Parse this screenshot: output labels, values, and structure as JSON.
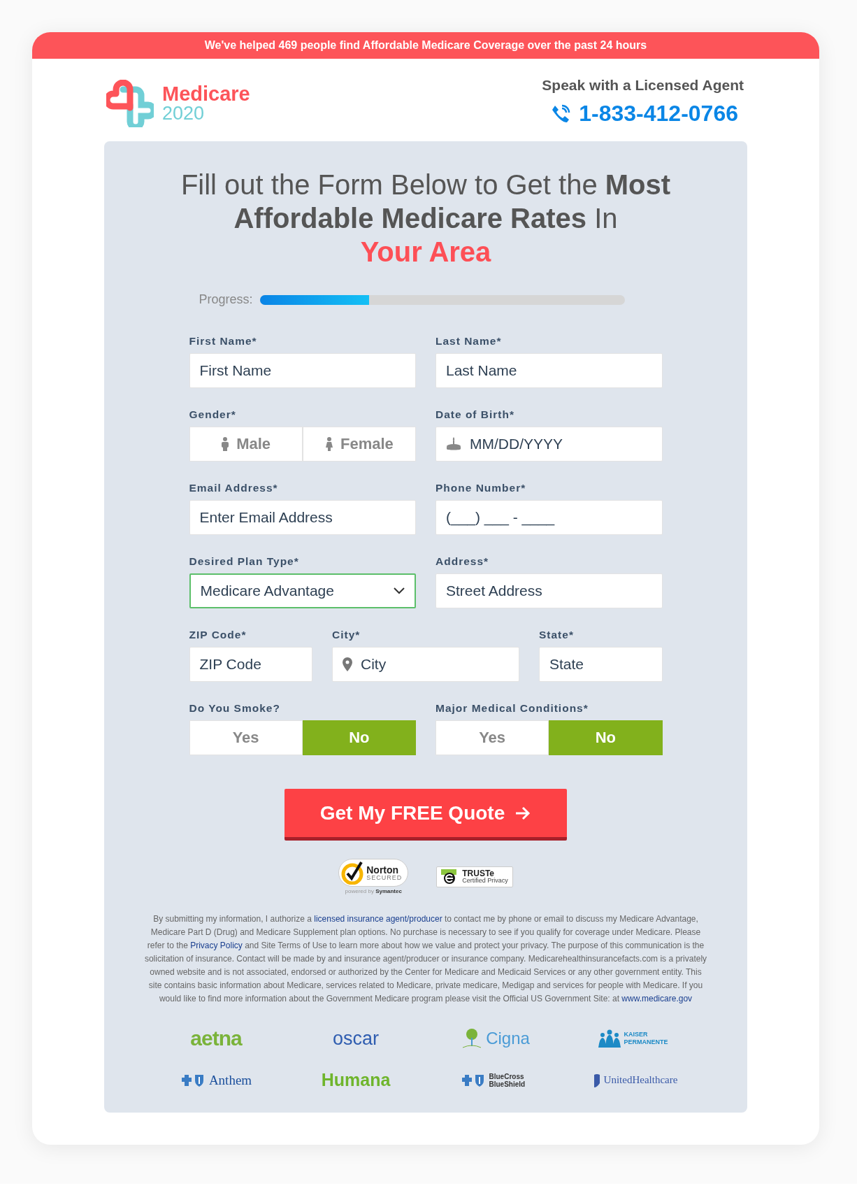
{
  "banner": "We've helped 469 people find Affordable Medicare Coverage over the past 24 hours",
  "header": {
    "brand_name": "Medicare",
    "brand_year": "2020",
    "agent_label": "Speak with a Licensed Agent",
    "phone": "1-833-412-0766"
  },
  "form": {
    "heading": "Fill out the Form Below to Get the **Most Affordable Medicare Rates** In",
    "heading_highlight": "Your Area",
    "progress": {
      "label": "Progress:",
      "level": 0.3
    },
    "rows": [
      {
        "fields": [
          {
            "kind": "text",
            "label": "First Name*",
            "placeholder": "First Name"
          },
          {
            "kind": "text",
            "label": "Last Name*",
            "placeholder": "Last Name"
          }
        ]
      },
      {
        "fields": [
          {
            "kind": "choice",
            "label": "Gender*",
            "options": [
              {
                "label": "Male",
                "kind": "male",
                "selected": false
              },
              {
                "label": "Female",
                "kind": "female",
                "selected": false
              }
            ]
          },
          {
            "kind": "date",
            "label": "Date of Birth*",
            "placeholder": "MM/DD/YYYY"
          }
        ]
      },
      {
        "fields": [
          {
            "kind": "text",
            "label": "Email Address*",
            "placeholder": "Enter Email Address"
          },
          {
            "kind": "text",
            "label": "Phone Number*",
            "placeholder": "(___) ___ - ____"
          }
        ]
      },
      {
        "fields": [
          {
            "kind": "select",
            "label": "Desired Plan Type*",
            "value": "Medicare Advantage",
            "valid": true
          },
          {
            "kind": "text",
            "label": "Address*",
            "placeholder": "Street Address"
          }
        ]
      },
      {
        "fields": [
          {
            "kind": "text",
            "label": "ZIP Code*",
            "placeholder": "ZIP Code"
          },
          {
            "kind": "city",
            "label": "City*",
            "placeholder": "City"
          },
          {
            "kind": "text",
            "label": "State*",
            "placeholder": "State"
          }
        ]
      },
      {
        "fields": [
          {
            "kind": "choice",
            "label": "Do You Smoke?",
            "options": [
              {
                "label": "Yes",
                "selected": false
              },
              {
                "label": "No",
                "selected": true
              }
            ]
          },
          {
            "kind": "choice",
            "label": "Major Medical Conditions*",
            "options": [
              {
                "label": "Yes",
                "selected": false
              },
              {
                "label": "No",
                "selected": true
              }
            ]
          }
        ]
      }
    ],
    "submit": "Get My FREE Quote"
  },
  "seals": {
    "norton": {
      "name": "Norton",
      "status": "SECURED",
      "powered_by": "powered by",
      "company": "Symantec"
    },
    "truste": {
      "name": "TRUSTe",
      "subtitle": "Certified Privacy"
    }
  },
  "disclaimer": [
    {
      "kind": "text",
      "text": "By submitting my information, I authorize a "
    },
    {
      "kind": "link",
      "text": "licensed insurance agent/producer"
    },
    {
      "kind": "text",
      "text": " to contact me by phone or email to discuss my Medicare Advantage, Medicare Part D (Drug) and Medicare Supplement plan options. No purchase is necessary to see if you qualify for coverage under Medicare. Please refer to the "
    },
    {
      "kind": "link",
      "text": "Privacy Policy"
    },
    {
      "kind": "text",
      "text": " and Site Terms of Use to learn more about how we value and protect your privacy. The purpose of this communication is the solicitation of insurance. Contact will be made by and insurance agent/producer or insurance company. Medicarehealthinsurancefacts.com is a privately owned website and is not associated, endorsed or authorized by the Center for Medicare and Medicaid Services or any other government entity. This site contains basic information about Medicare, services related to Medicare, private medicare, Medigap and services for people with Medicare. If you would like to find more information about the Government Medicare program please visit the Official US Government Site: at "
    },
    {
      "kind": "link",
      "text": "www.medicare.gov"
    }
  ],
  "insurers": [
    {
      "kind": "aetna",
      "name": "aetna"
    },
    {
      "kind": "oscar",
      "name": "oscar"
    },
    {
      "kind": "cigna",
      "name": "Cigna"
    },
    {
      "kind": "kaiser",
      "name": "KAISER PERMANENTE"
    },
    {
      "kind": "anthem",
      "name": "Anthem"
    },
    {
      "kind": "humana",
      "name": "Humana"
    },
    {
      "kind": "bcbs",
      "name": "BlueCross BlueShield"
    },
    {
      "kind": "united",
      "name": "UnitedHealthcare"
    }
  ]
}
